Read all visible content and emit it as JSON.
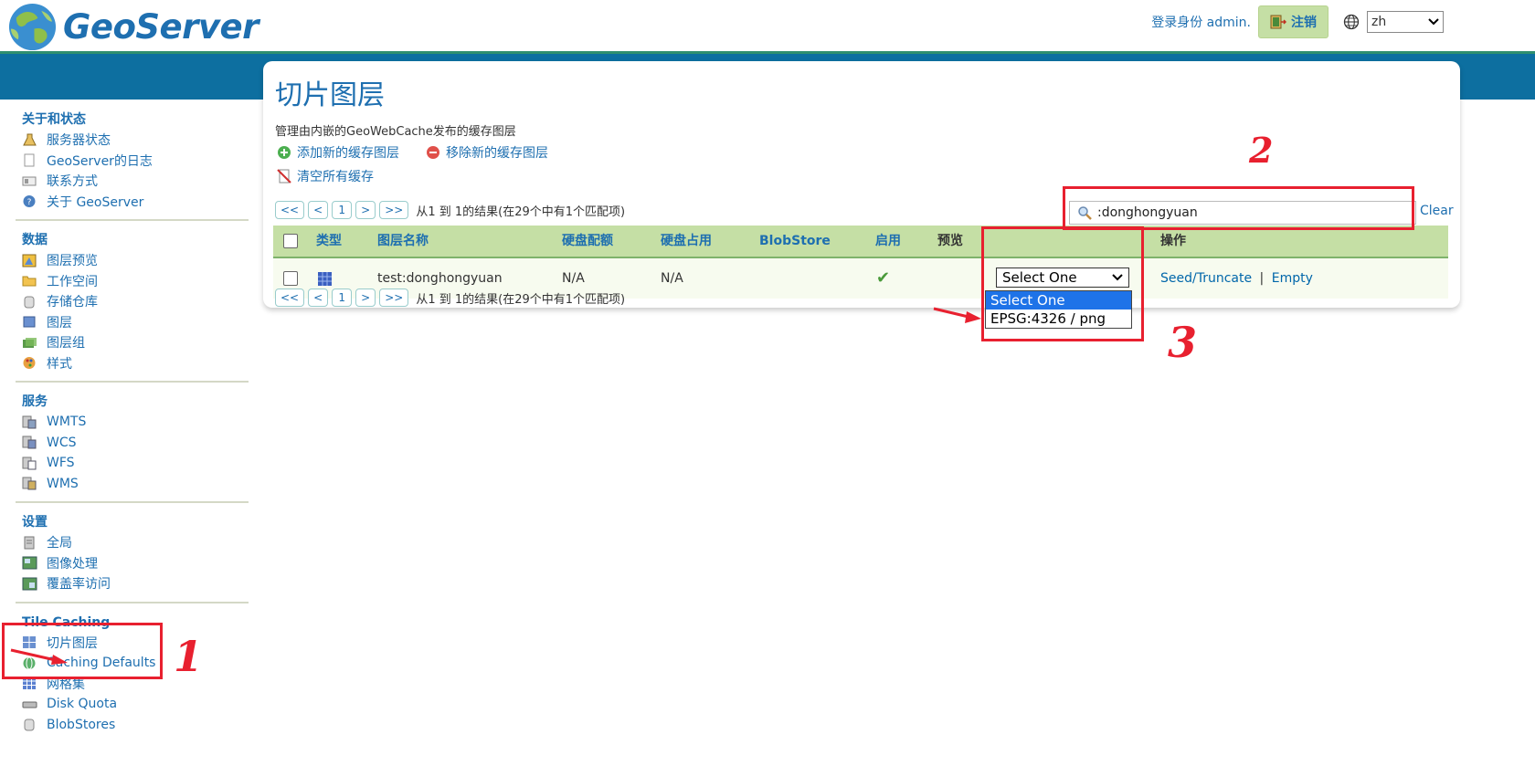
{
  "header": {
    "logo_text": "GeoServer",
    "login_label": "登录身份 admin.",
    "logout_label": "注销",
    "language": "zh"
  },
  "sidebar": {
    "sections": [
      {
        "title": "关于和状态",
        "items": [
          "服务器状态",
          "GeoServer的日志",
          "联系方式",
          "关于 GeoServer"
        ]
      },
      {
        "title": "数据",
        "items": [
          "图层预览",
          "工作空间",
          "存储仓库",
          "图层",
          "图层组",
          "样式"
        ]
      },
      {
        "title": "服务",
        "items": [
          "WMTS",
          "WCS",
          "WFS",
          "WMS"
        ]
      },
      {
        "title": "设置",
        "items": [
          "全局",
          "图像处理",
          "覆盖率访问"
        ]
      },
      {
        "title": "Tile Caching",
        "items": [
          "切片图层",
          "Caching Defaults",
          "网格集",
          "Disk Quota",
          "BlobStores"
        ]
      }
    ]
  },
  "main": {
    "title": "切片图层",
    "description": "管理由内嵌的GeoWebCache发布的缓存图层",
    "add_label": "添加新的缓存图层",
    "remove_label": "移除新的缓存图层",
    "clear_all_label": "清空所有缓存",
    "pager": {
      "first": "<<",
      "prev": "<",
      "page": "1",
      "next": ">",
      "last": ">>",
      "summary": "从1 到 1的结果(在29个中有1个匹配项)"
    },
    "search_value": ":donghongyuan",
    "clear_label": "Clear",
    "table": {
      "headers": [
        "类型",
        "图层名称",
        "硬盘配额",
        "硬盘占用",
        "BlobStore",
        "启用",
        "预览",
        "操作"
      ],
      "row": {
        "name": "test:donghongyuan",
        "quota": "N/A",
        "usage": "N/A",
        "blobstore": "",
        "enabled": "✔",
        "preview_selected": "Select One",
        "seed": "Seed/Truncate",
        "separator": "|",
        "empty": "Empty"
      },
      "preview_options": [
        "Select One",
        "EPSG:4326 / png"
      ]
    }
  },
  "annotations": [
    "1",
    "2",
    "3"
  ],
  "colors": {
    "accent": "#1e6fb0",
    "band": "#0d6fa0",
    "table_header": "#c5dfa5",
    "annotation": "#e8202f"
  }
}
